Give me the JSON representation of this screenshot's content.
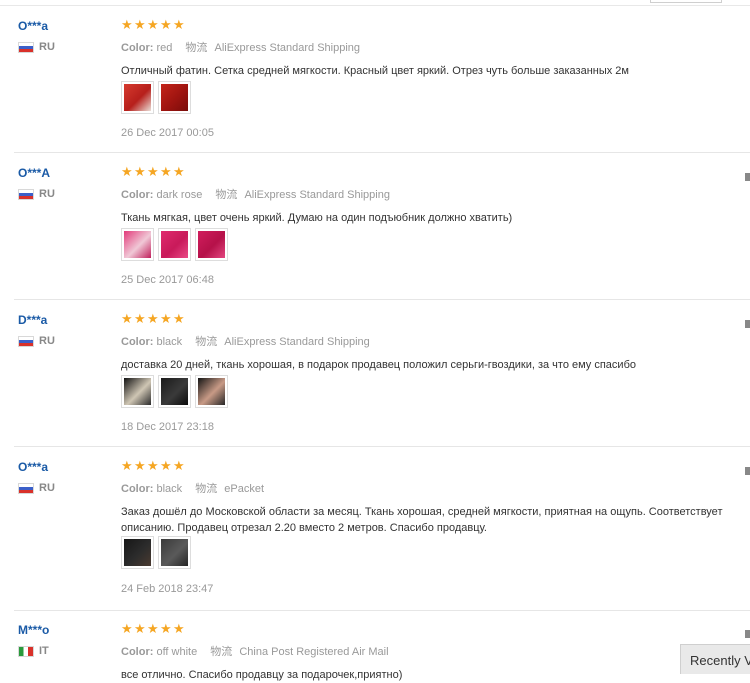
{
  "reviews": [
    {
      "user": "O***a",
      "country": "RU",
      "flag": "ru-flag",
      "rating": 5,
      "color_label": "Color:",
      "color": "red",
      "shipping_zh": "物流",
      "shipping": "AliExpress Standard Shipping",
      "text": "Отличный фатин. Сетка средней мягкости. Красный цвет яркий. Отрез чуть больше заказанных 2м",
      "photos": [
        {
          "colors": [
            "#d63a2e",
            "#b61f1b",
            "#eadfd8"
          ]
        },
        {
          "colors": [
            "#c42419",
            "#9e1410",
            "#7a0d0a"
          ]
        }
      ],
      "date": "26 Dec 2017 00:05"
    },
    {
      "user": "O***A",
      "country": "RU",
      "flag": "ru-flag",
      "rating": 5,
      "color_label": "Color:",
      "color": "dark rose",
      "shipping_zh": "物流",
      "shipping": "AliExpress Standard Shipping",
      "text": "Ткань мягкая, цвет очень яркий. Думаю на один подъюбник должно хватить)",
      "photos": [
        {
          "colors": [
            "#e23a7a",
            "#f0c8d6",
            "#c01f5c"
          ]
        },
        {
          "colors": [
            "#e02a6e",
            "#c81a5a",
            "#ea4a86"
          ]
        },
        {
          "colors": [
            "#d11d5d",
            "#b51149",
            "#e34680"
          ]
        }
      ],
      "date": "25 Dec 2017 06:48"
    },
    {
      "user": "D***a",
      "country": "RU",
      "flag": "ru-flag",
      "rating": 5,
      "color_label": "Color:",
      "color": "black",
      "shipping_zh": "物流",
      "shipping": "AliExpress Standard Shipping",
      "text": "доставка 20 дней, ткань хорошая, в подарок продавец положил серьги-гвоздики, за что ему спасибо",
      "photos": [
        {
          "colors": [
            "#111111",
            "#cfc6b4",
            "#2a2a2a"
          ]
        },
        {
          "colors": [
            "#1a1a1a",
            "#3a3a3a",
            "#0c0c0c"
          ]
        },
        {
          "colors": [
            "#141414",
            "#c89a86",
            "#262626"
          ]
        }
      ],
      "date": "18 Dec 2017 23:18"
    },
    {
      "user": "O***a",
      "country": "RU",
      "flag": "ru-flag",
      "rating": 5,
      "color_label": "Color:",
      "color": "black",
      "shipping_zh": "物流",
      "shipping": "ePacket",
      "text": "Заказ дошёл до Московской области за месяц. Ткань хорошая, средней мягкости, приятная на ощупь. Соответствует описанию. Продавец отрезал 2.20 вместо 2 метров. Спасибо продавцу.",
      "photos": [
        {
          "colors": [
            "#161616",
            "#2c2c2c",
            "#4a3a30"
          ]
        },
        {
          "colors": [
            "#3a3a3a",
            "#5a5a5a",
            "#262626"
          ]
        }
      ],
      "date": "24 Feb 2018 23:47"
    },
    {
      "user": "M***o",
      "country": "IT",
      "flag": "it-flag",
      "rating": 5,
      "color_label": "Color:",
      "color": "off white",
      "shipping_zh": "物流",
      "shipping": "China Post Registered Air Mail",
      "text": "все отлично. Спасибо продавцу за подарочек,приятно)",
      "photos": [],
      "date": ""
    }
  ],
  "recently_viewed_tab": "Recently Vi",
  "star_glyph": "★",
  "star_color": "#f5a623",
  "username_color": "#1a5aa6"
}
